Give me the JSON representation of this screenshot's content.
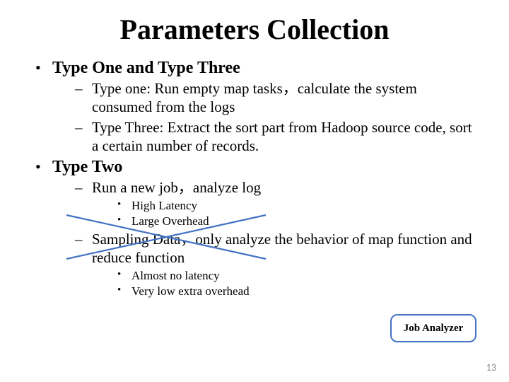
{
  "title": "Parameters Collection",
  "bullets": {
    "a": {
      "heading": "Type One and Type Three",
      "sub1": "Type one: Run empty map tasks，calculate the system consumed from the logs",
      "sub2": "Type Three: Extract the sort part from Hadoop source code, sort a certain number of records."
    },
    "b": {
      "heading": "Type Two",
      "sub1": {
        "text": "Run a new job，analyze log",
        "pt1": "High Latency",
        "pt2": "Large Overhead"
      },
      "sub2": {
        "text": "Sampling Data，only analyze the behavior of map function and reduce function",
        "pt1": "Almost no latency",
        "pt2": "Very low extra overhead"
      }
    }
  },
  "callout": "Job Analyzer",
  "page_number": "13"
}
